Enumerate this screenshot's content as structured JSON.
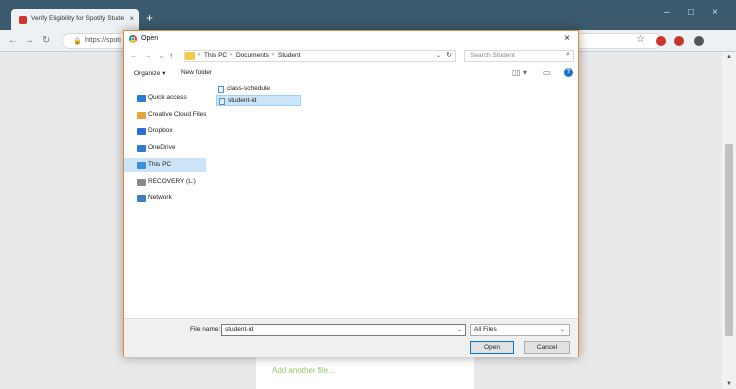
{
  "browser": {
    "tab_title": "Verify Eligibility for Spotify Stude",
    "tab_close": "×",
    "new_tab": "+",
    "address_url": "https://spoti",
    "window_controls": [
      "–",
      "□",
      "×"
    ],
    "back_glyph": "←",
    "forward_glyph": "→",
    "reload_glyph": "↻",
    "lock_glyph": "🔒",
    "bookmark_glyph": "☆",
    "extension_colors": [
      "#d4322c",
      "#c0392b",
      "#555555"
    ]
  },
  "page": {
    "add_file_link": "Add another file...",
    "accent_color": "#9cbf6a"
  },
  "dialog": {
    "title": "Open",
    "close": "×",
    "nav": {
      "back": "←",
      "forward": "→",
      "recent": "⌄",
      "up": "↑"
    },
    "breadcrumb": [
      "This PC",
      "Documents",
      "Student"
    ],
    "breadcrumb_separator": "›",
    "search_placeholder": "Search Student",
    "search_glyph": "⌕",
    "organize_label": "Organize ▾",
    "new_folder_label": "New folder",
    "nav_items": [
      {
        "label": "Quick access",
        "icon": "star-icon",
        "color": "#2b7cd3",
        "selected": false
      },
      {
        "label": "Creative Cloud Files",
        "icon": "creative-cloud-icon",
        "color": "#e8a33c",
        "selected": false
      },
      {
        "label": "Dropbox",
        "icon": "dropbox-icon",
        "color": "#2b6fd6",
        "selected": false
      },
      {
        "label": "OneDrive",
        "icon": "cloud-icon",
        "color": "#2f7ccd",
        "selected": false
      },
      {
        "label": "This PC",
        "icon": "computer-icon",
        "color": "#3d8ee0",
        "selected": true
      },
      {
        "label": "RECOVERY (L:)",
        "icon": "drive-icon",
        "color": "#8a8a8a",
        "selected": false
      },
      {
        "label": "Network",
        "icon": "network-icon",
        "color": "#3d7fbf",
        "selected": false
      }
    ],
    "files": [
      {
        "name": "class-schedule",
        "icon": "document-icon",
        "selected": false
      },
      {
        "name": "student-id",
        "icon": "document-icon",
        "selected": true
      }
    ],
    "file_name_label": "File name:",
    "file_name_value": "student-id",
    "file_type": "All Files",
    "open_button": "Open",
    "cancel_button": "Cancel",
    "border_color": "#e08a3c",
    "selection_color": "#cce4f7"
  }
}
